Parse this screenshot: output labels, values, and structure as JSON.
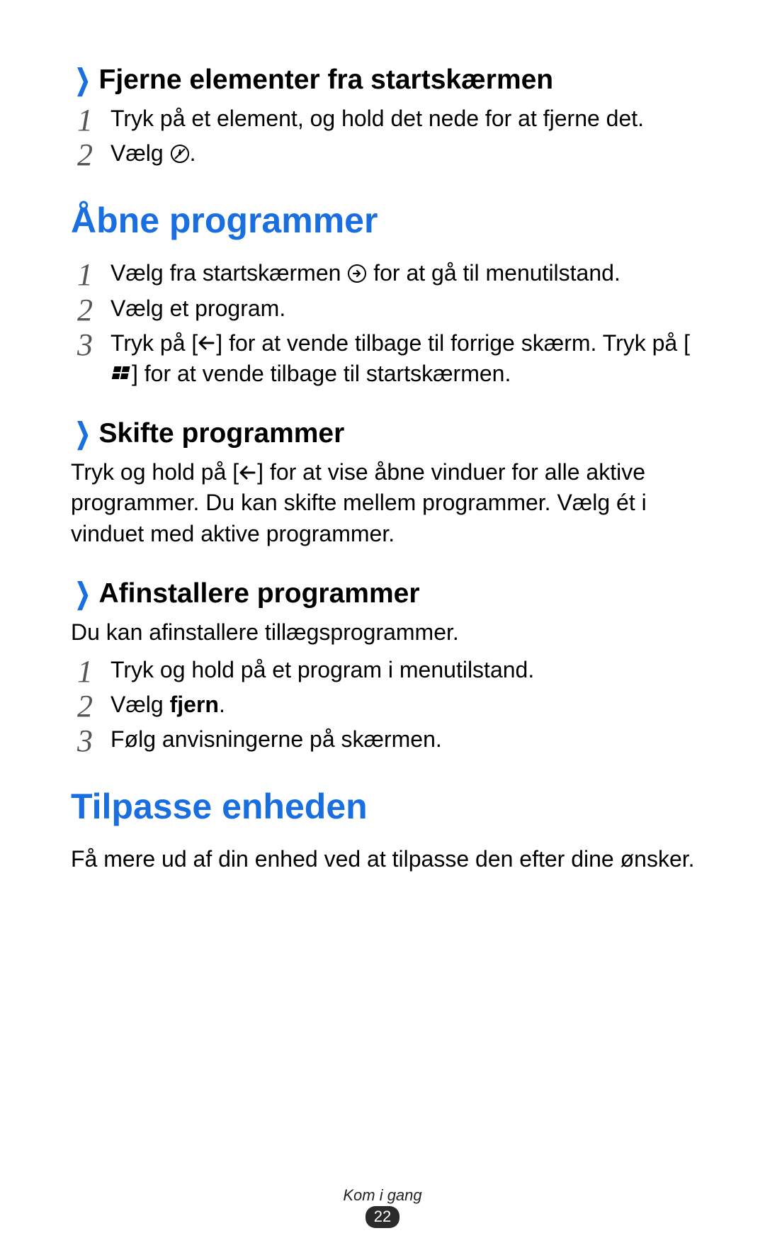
{
  "section_remove": {
    "heading": "Fjerne elementer fra startskærmen",
    "steps": [
      "Tryk på et element, og hold det nede for at fjerne det.",
      "Vælg "
    ],
    "step2_suffix": "."
  },
  "section_open": {
    "heading": "Åbne programmer",
    "step1_prefix": "Vælg fra startskærmen ",
    "step1_suffix": " for at gå til menutilstand.",
    "step2": "Vælg et program.",
    "step3_prefix": "Tryk på [",
    "step3_mid": "] for at vende tilbage til forrige skærm. Tryk på [",
    "step3_suffix": "] for at vende tilbage til startskærmen."
  },
  "section_switch": {
    "heading": "Skifte programmer",
    "body_prefix": "Tryk og hold på [",
    "body_suffix": "] for at vise åbne vinduer for alle aktive programmer. Du kan skifte mellem programmer. Vælg ét i vinduet med aktive programmer."
  },
  "section_uninstall": {
    "heading": "Afinstallere programmer",
    "intro": "Du kan afinstallere tillægsprogrammer.",
    "step1": "Tryk og hold på et program i menutilstand.",
    "step2_prefix": "Vælg ",
    "step2_bold": "fjern",
    "step2_suffix": ".",
    "step3": "Følg anvisningerne på skærmen."
  },
  "section_customise": {
    "heading": "Tilpasse enheden",
    "body": "Få mere ud af din enhed ved at tilpasse den efter dine ønsker."
  },
  "footer": {
    "label": "Kom i gang",
    "page": "22"
  }
}
